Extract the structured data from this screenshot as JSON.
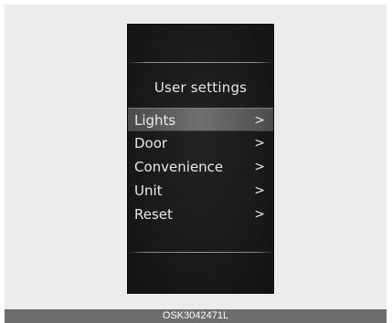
{
  "screen": {
    "title": "User settings",
    "items": [
      {
        "label": "Lights",
        "chevron": ">",
        "selected": true
      },
      {
        "label": "Door",
        "chevron": ">",
        "selected": false
      },
      {
        "label": "Convenience",
        "chevron": ">",
        "selected": false
      },
      {
        "label": "Unit",
        "chevron": ">",
        "selected": false
      },
      {
        "label": "Reset",
        "chevron": ">",
        "selected": false
      }
    ]
  },
  "caption": "OSK3042471L",
  "colors": {
    "screen_background": "#1a1a1a",
    "selection_highlight": "#707070",
    "text": "#e9e9e9",
    "caption_bar": "#6d6d6d"
  }
}
